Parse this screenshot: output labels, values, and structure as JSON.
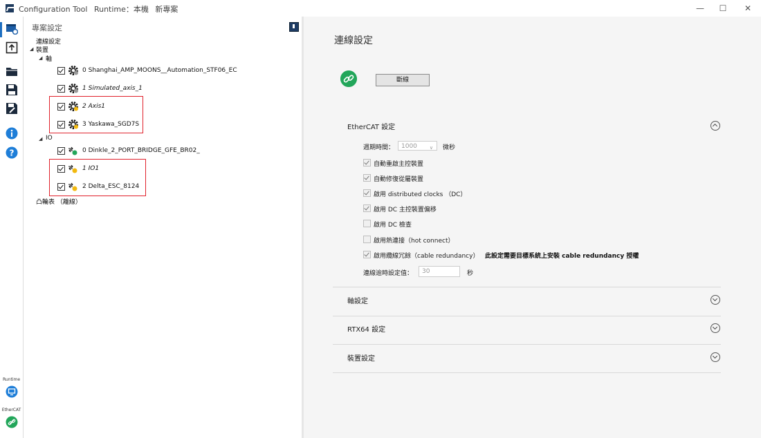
{
  "titlebar": {
    "app_name": "Configuration Tool",
    "runtime_label": "Runtime：本機",
    "project_label": "新專案",
    "minimize": "—",
    "maximize": "☐",
    "close": "✕"
  },
  "leftbar": {
    "runtime_caption": "Runtime",
    "ethercat_caption": "EtherCAT"
  },
  "tree": {
    "panel_title": "專案設定",
    "connection_node": "連線設定",
    "devices_node": "裝置",
    "axis_node": "軸",
    "axes": [
      {
        "index": "0",
        "name": "Shanghai_AMP_MOONS__Automation_STF06_EC"
      },
      {
        "index": "1",
        "name": "Simulated_axis_1"
      },
      {
        "index": "2",
        "name": "Axis1"
      },
      {
        "index": "3",
        "name": "Yaskawa_SGD7S"
      }
    ],
    "io_node": "IO",
    "ios": [
      {
        "index": "0",
        "name": "Dinkle_2_PORT_BRIDGE_GFE_BR02_"
      },
      {
        "index": "1",
        "name": "IO1"
      },
      {
        "index": "2",
        "name": "Delta_ESC_8124"
      }
    ],
    "cam_table": "凸輪表 （離線）"
  },
  "main": {
    "title": "連線設定",
    "disconnect_button": "斷線",
    "ethercat_section": {
      "title": "EtherCAT 設定",
      "cycle_label": "週期時間：",
      "cycle_value": "1000",
      "cycle_unit": "微秒",
      "options": [
        {
          "label": "自動重啟主控裝置",
          "checked": true
        },
        {
          "label": "自動修復從屬裝置",
          "checked": true
        },
        {
          "label": "啟用 distributed clocks （DC）",
          "checked": true
        },
        {
          "label": "啟用 DC 主控裝置偏移",
          "checked": true
        },
        {
          "label": "啟用 DC 檢查",
          "checked": false
        },
        {
          "label": "啟用熱連接（hot connect）",
          "checked": false
        },
        {
          "label": "啟用纜線冗餘（cable redundancy）",
          "checked": true
        }
      ],
      "redundancy_note": "此設定需要目標系統上安裝 cable redundancy 授權",
      "timeout_label": "連線逾時設定值：",
      "timeout_value": "30",
      "timeout_unit": "秒"
    },
    "axis_section": {
      "title": "軸設定"
    },
    "rtx_section": {
      "title": "RTX64 設定"
    },
    "device_section": {
      "title": "裝置設定"
    }
  },
  "colors": {
    "accent": "#1e6fc1",
    "highlight_box": "#e0202a",
    "connected_green": "#22a65a"
  }
}
